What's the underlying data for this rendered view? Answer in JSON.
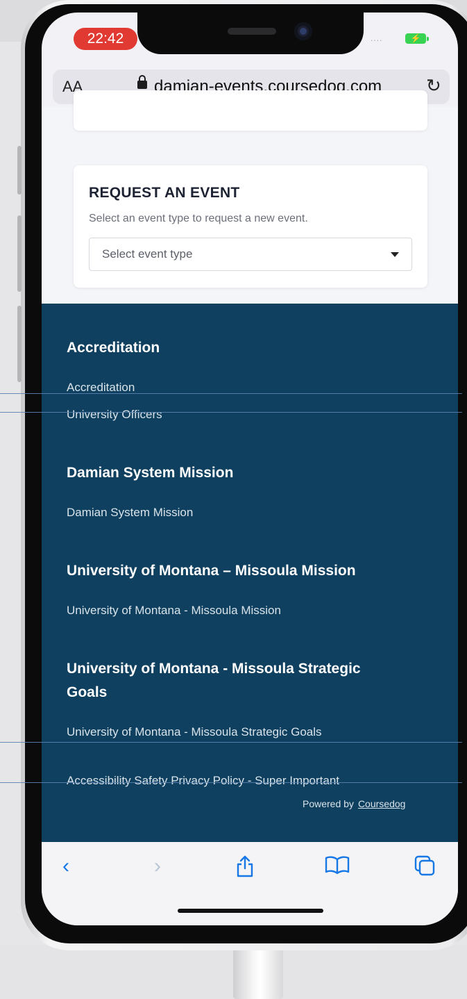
{
  "status_bar": {
    "time": "22:42",
    "signal": "....",
    "battery_glyph": "⚡"
  },
  "browser": {
    "text_size_label": "AA",
    "url": "damian-events.coursedog.com",
    "icons": {
      "lock": "lock-icon",
      "reload": "reload-icon"
    }
  },
  "request_card": {
    "title": "REQUEST AN EVENT",
    "subtitle": "Select an event type to request a new event.",
    "select_placeholder": "Select event type"
  },
  "footer": {
    "sections": [
      {
        "heading": "Accreditation",
        "links": [
          "Accreditation",
          "University Officers"
        ]
      },
      {
        "heading": "Damian System Mission",
        "links": [
          "Damian System Mission"
        ]
      },
      {
        "heading": "University of Montana – Missoula Mission",
        "links": [
          "University of Montana - Missoula Mission"
        ]
      },
      {
        "heading_line1": "University of Montana - Missoula Strategic",
        "heading_line2": "Goals",
        "links": [
          "University of Montana - Missoula Strategic Goals"
        ]
      }
    ],
    "bottom_links": "Accessibility Safety Privacy Policy - Super Important",
    "powered_by": "Powered by",
    "powered_link": "Coursedog"
  },
  "toolbar": {
    "back": "‹",
    "forward": "›",
    "share": "⇧",
    "bookmarks": "📖",
    "tabs": "⧉"
  },
  "colors": {
    "footer_bg": "#0f405f",
    "accent": "#1677e6",
    "time_pill": "#e03a33"
  }
}
